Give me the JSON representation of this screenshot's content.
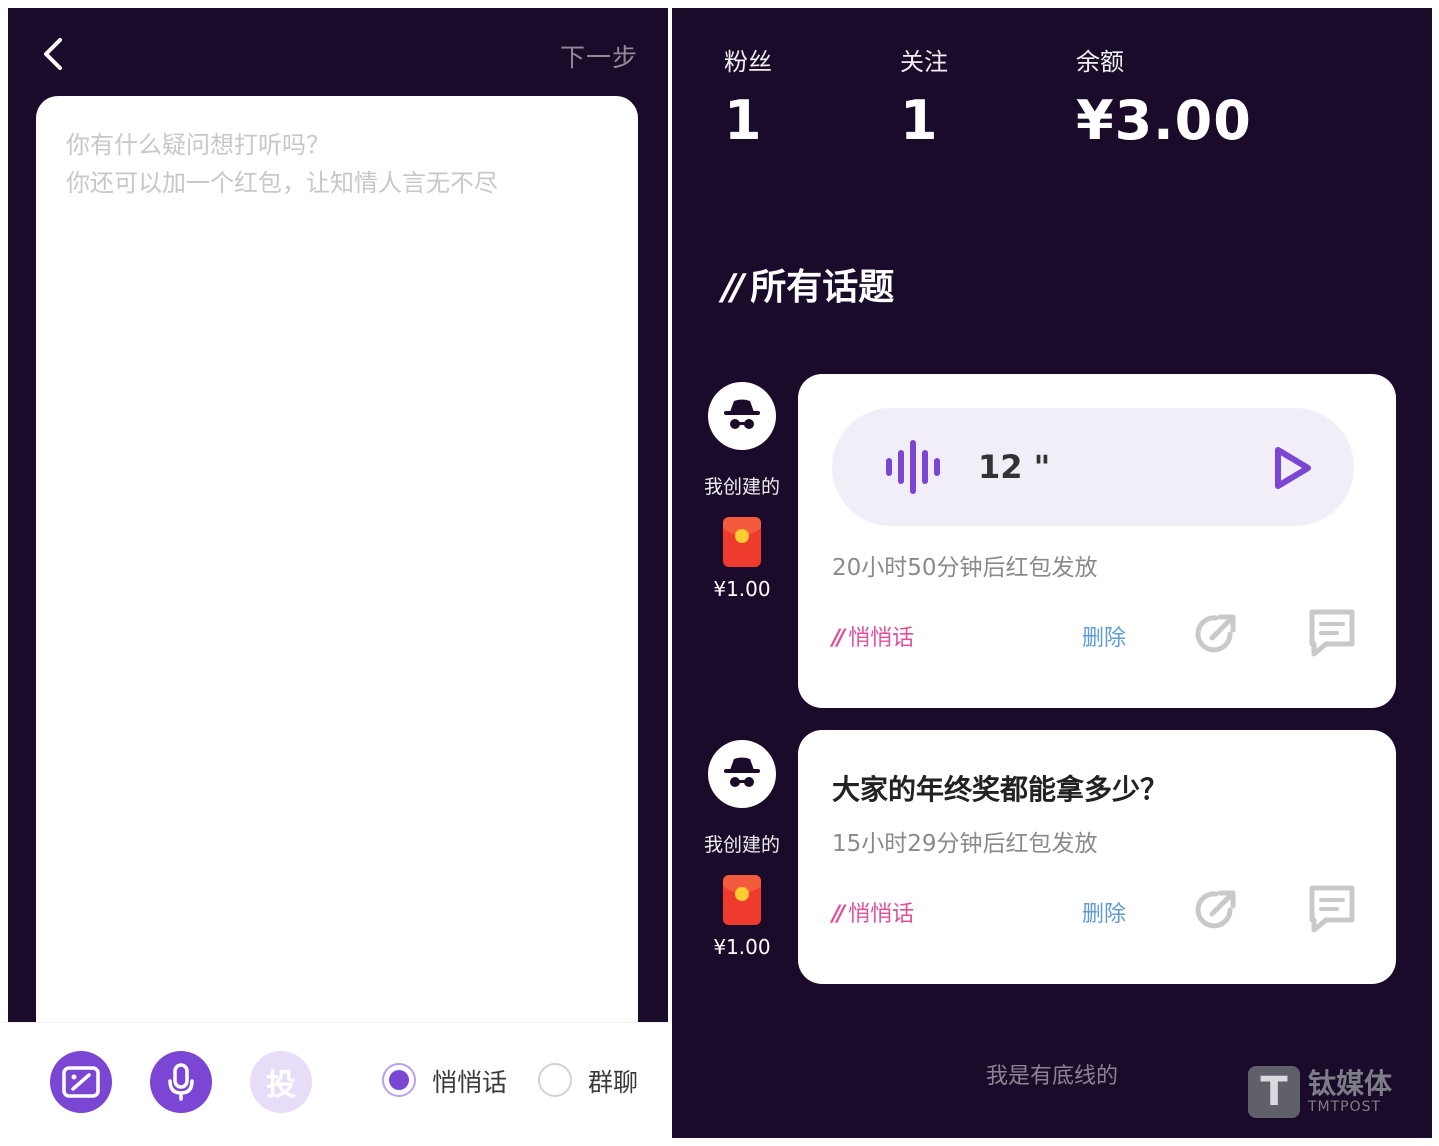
{
  "compose": {
    "next_label": "下一步",
    "placeholder_line1": "你有什么疑问想打听吗？",
    "placeholder_line2": "你还可以加一个红包，让知情人言无不尽",
    "toolbar": {
      "image_icon": "image-icon",
      "mic_icon": "mic-icon",
      "send_label": "投",
      "options": [
        {
          "label": "悄悄话",
          "selected": true
        },
        {
          "label": "群聊",
          "selected": false
        }
      ]
    },
    "accent_color": "#7a46d3"
  },
  "profile": {
    "stats": [
      {
        "label": "粉丝",
        "value": "1"
      },
      {
        "label": "关注",
        "value": "1"
      },
      {
        "label": "余额",
        "value": "¥3.00"
      }
    ],
    "section_title_mark": "//",
    "section_title": "所有话题"
  },
  "topics": [
    {
      "creator_label": "我创建的",
      "reward": "¥1.00",
      "type": "voice",
      "duration": "12 \"",
      "timer": "20小时50分钟后红包发放",
      "tag_mark": "//",
      "tag": "悄悄话",
      "delete_label": "删除"
    },
    {
      "creator_label": "我创建的",
      "reward": "¥1.00",
      "type": "text",
      "question": "大家的年终奖都能拿多少？",
      "timer": "15小时29分钟后红包发放",
      "tag_mark": "//",
      "tag": "悄悄话",
      "delete_label": "删除"
    }
  ],
  "footer": "我是有底线的",
  "watermark": {
    "logo": "T",
    "cn": "钛媒体",
    "en": "TMTPOST"
  }
}
